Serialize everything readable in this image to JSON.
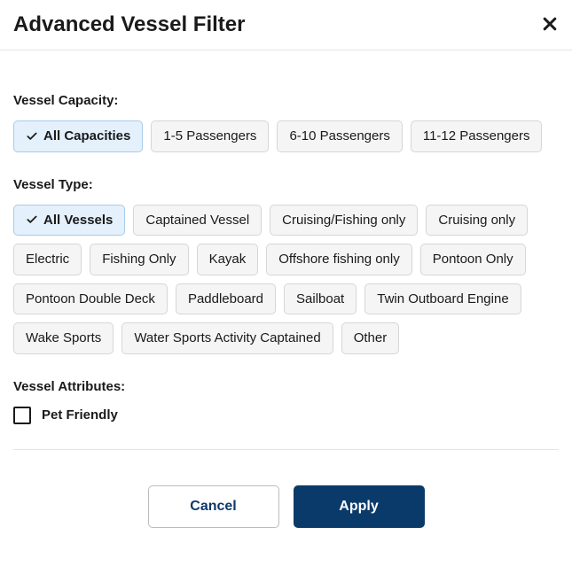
{
  "modal": {
    "title": "Advanced Vessel Filter"
  },
  "capacity": {
    "label": "Vessel Capacity:",
    "options": [
      {
        "label": "All Capacities",
        "selected": true
      },
      {
        "label": "1-5 Passengers",
        "selected": false
      },
      {
        "label": "6-10 Passengers",
        "selected": false
      },
      {
        "label": "11-12 Passengers",
        "selected": false
      }
    ]
  },
  "type": {
    "label": "Vessel Type:",
    "options": [
      {
        "label": "All Vessels",
        "selected": true
      },
      {
        "label": "Captained Vessel",
        "selected": false
      },
      {
        "label": "Cruising/Fishing only",
        "selected": false
      },
      {
        "label": "Cruising only",
        "selected": false
      },
      {
        "label": "Electric",
        "selected": false
      },
      {
        "label": "Fishing Only",
        "selected": false
      },
      {
        "label": "Kayak",
        "selected": false
      },
      {
        "label": "Offshore fishing only",
        "selected": false
      },
      {
        "label": "Pontoon Only",
        "selected": false
      },
      {
        "label": "Pontoon Double Deck",
        "selected": false
      },
      {
        "label": "Paddleboard",
        "selected": false
      },
      {
        "label": "Sailboat",
        "selected": false
      },
      {
        "label": "Twin Outboard Engine",
        "selected": false
      },
      {
        "label": "Wake Sports",
        "selected": false
      },
      {
        "label": "Water Sports Activity Captained",
        "selected": false
      },
      {
        "label": "Other",
        "selected": false
      }
    ]
  },
  "attributes": {
    "label": "Vessel Attributes:",
    "options": [
      {
        "label": "Pet Friendly",
        "checked": false
      }
    ]
  },
  "footer": {
    "cancel_label": "Cancel",
    "apply_label": "Apply"
  }
}
